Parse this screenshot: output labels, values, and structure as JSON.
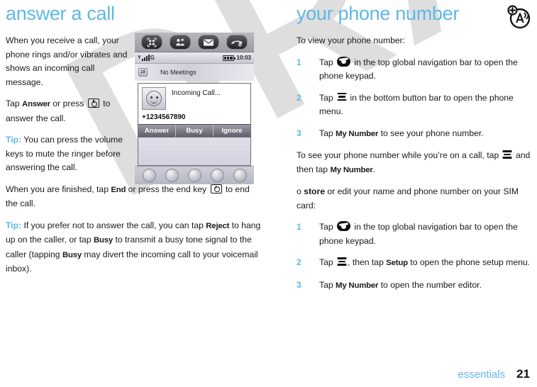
{
  "watermark": {
    "text": "DRAFT"
  },
  "left_column": {
    "title": "answer a call",
    "p1": "When you receive a call, your phone rings and/or vibrates and shows an incoming call message.",
    "p2_pre": "Tap ",
    "p2_bold1": "Answer",
    "p2_mid": " or press ",
    "p2_post": " to answer the call.",
    "tip1_label": "Tip:",
    "tip1_text": " You can press the volume keys to mute the ringer before answering the call.",
    "p3_pre": "When you are finished, tap ",
    "p3_bold": "End",
    "p3_mid": " or press the end key ",
    "p3_post": " to end the call.",
    "tip2_label": "Tip:",
    "tip2_a": " If you prefer not to answer the call, you can tap ",
    "tip2_b1": "Reject",
    "tip2_c": " to hang up on the caller, or tap ",
    "tip2_b2": "Busy",
    "tip2_d": " to transmit a busy tone signal to the caller (tapping ",
    "tip2_b3": "Busy",
    "tip2_e": " may divert the incoming call to your voicemail inbox)."
  },
  "phone_screenshot": {
    "nav_icons": [
      "apps-grid-icon",
      "contacts-icon",
      "message-envelope-icon",
      "phone-handset-icon"
    ],
    "status": {
      "network_label": "G",
      "time": "10:03",
      "signal_icon": "signal-bars-icon",
      "battery_icon": "battery-icon"
    },
    "meetings": {
      "icon_label": "15",
      "text": "No Meetings"
    },
    "call_card": {
      "avatar_icon": "smiley-avatar-icon",
      "title": "Incoming Call...",
      "number": "+1234567890"
    },
    "softkeys": [
      "Answer",
      "Busy",
      "Ignore"
    ],
    "dock_icons": [
      "dock-icon-1",
      "dock-icon-2",
      "dock-icon-3",
      "dock-icon-4",
      "dock-icon-5"
    ]
  },
  "right_column": {
    "title": "your phone number",
    "corner_icon": "antenna-add-icon",
    "intro": "To view your phone number:",
    "steps_view": [
      {
        "num": "1",
        "pre": "Tap ",
        "icon": "phone-handset-icon",
        "post": " in the top global navigation bar to open the phone keypad."
      },
      {
        "num": "2",
        "pre": "Tap ",
        "icon": "menu-icon",
        "post": " in the bottom button bar to open the phone menu."
      },
      {
        "num": "3",
        "pre": "Tap ",
        "bold": "My Number",
        "post": " to see your phone number."
      }
    ],
    "oncall_pre": "To see your phone number while you’re on a call, tap ",
    "oncall_mid": " and then tap ",
    "oncall_bold": "My Number",
    "oncall_post": ".",
    "store_pre": "o ",
    "store_bold": "store",
    "store_post": " or edit your name and phone number on your SIM card:",
    "steps_store": [
      {
        "num": "1",
        "pre": "Tap ",
        "icon": "phone-handset-icon",
        "post": " in the top global navigation bar to open the phone keypad."
      },
      {
        "num": "2",
        "pre": "Tap ",
        "icon": "menu-icon",
        "mid": ", then tap ",
        "bold": "Setup",
        "post": " to open the phone setup menu."
      },
      {
        "num": "3",
        "pre": "Tap ",
        "bold": "My Number",
        "post": " to open the number editor."
      }
    ]
  },
  "footer": {
    "label": "essentials",
    "page_number": "21"
  },
  "colors": {
    "accent_blue": "#5fb7e8",
    "text": "#1a1a1a",
    "watermark_grey": "#d9d9d9"
  }
}
